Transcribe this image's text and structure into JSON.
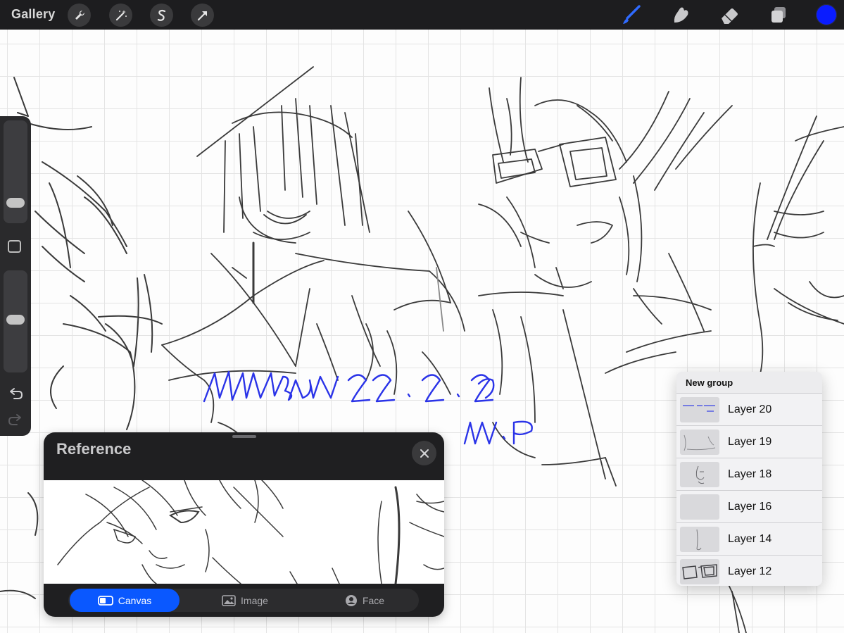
{
  "topbar": {
    "gallery_label": "Gallery",
    "left_tools": [
      "wrench-icon",
      "magic-wand-icon",
      "selection-icon",
      "transform-arrow-icon"
    ],
    "right_tools": [
      "brush-icon",
      "smudge-icon",
      "eraser-icon",
      "layers-icon"
    ],
    "current_color": "#0a1cff"
  },
  "canvas": {
    "signature_text": "KAIKBUU 22.2.26",
    "signature_initials": "W.R",
    "signature_color": "#2a33e8"
  },
  "sidebar": {
    "brush_size_level": 0.76,
    "opacity_level": 0.54,
    "undo_icon": "undo-icon",
    "redo_icon": "redo-icon"
  },
  "layers": {
    "group_name": "New group",
    "items": [
      {
        "name": "Layer 20"
      },
      {
        "name": "Layer 19"
      },
      {
        "name": "Layer 18"
      },
      {
        "name": "Layer 16"
      },
      {
        "name": "Layer 14"
      },
      {
        "name": "Layer 12"
      }
    ]
  },
  "reference": {
    "title": "Reference",
    "tabs": [
      {
        "label": "Canvas",
        "icon": "canvas-icon",
        "active": true
      },
      {
        "label": "Image",
        "icon": "image-icon",
        "active": false
      },
      {
        "label": "Face",
        "icon": "face-icon",
        "active": false
      }
    ]
  }
}
